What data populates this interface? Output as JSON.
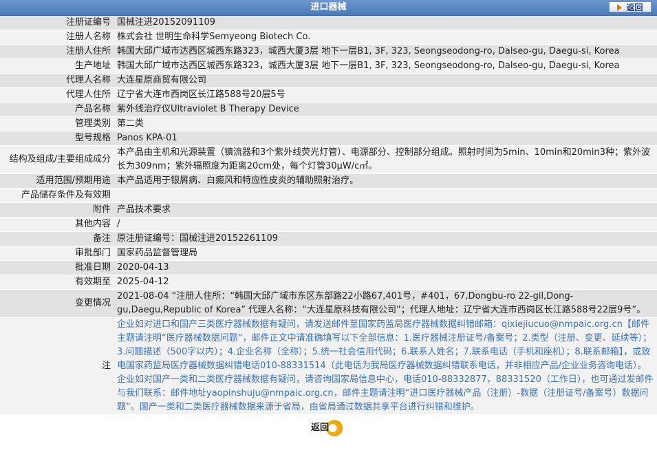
{
  "header": {
    "title": "进口器械",
    "back_label": "返回"
  },
  "rows": [
    {
      "label": "注册证编号",
      "value": "国械注进20152091109"
    },
    {
      "label": "注册人名称",
      "value": "株式会社 世明生命科学Semyeong Biotech Co."
    },
    {
      "label": "注册人住所",
      "value": "韩国大邱广域市达西区城西东路323，城西大厦3层 地下一层B1, 3F, 323, Seongseodong-ro, Dalseo-gu, Daegu-si, Korea"
    },
    {
      "label": "生产地址",
      "value": "韩国大邱广域市达西区城西东路323，城西大厦3层 地下一层B1, 3F, 323, Seongseodong-ro, Dalseo-gu, Daegu-si, Korea"
    },
    {
      "label": "代理人名称",
      "value": "大连星原商贸有限公司"
    },
    {
      "label": "代理人住所",
      "value": "辽宁省大连市西岗区长江路588号20层5号"
    },
    {
      "label": "产品名称",
      "value": "紫外线治疗仪Ultraviolet B Therapy Device"
    },
    {
      "label": "管理类别",
      "value": "第二类"
    },
    {
      "label": "型号规格",
      "value": "Panos KPA-01"
    },
    {
      "label": "结构及组成/主要组成成分",
      "value": "本产品由主机和光源装置（镇流器和3个紫外线荧光灯管）、电源部分、控制部分组成。照射时间为5min、10min和20min3种；紫外波长为309nm；紫外辐照度为距离20cm处，每个灯管30μW/c㎡。"
    },
    {
      "label": "适用范围/预期用途",
      "value": "本产品适用于银屑病、白癜风和特应性皮炎的辅助照射治疗。"
    },
    {
      "label": "产品储存条件及有效期",
      "value": ""
    },
    {
      "label": "附件",
      "value": "产品技术要求"
    },
    {
      "label": "其他内容",
      "value": "/"
    },
    {
      "label": "备注",
      "value": "原注册证编号：国械注进20152261109"
    },
    {
      "label": "审批部门",
      "value": "国家药品监督管理局"
    },
    {
      "label": "批准日期",
      "value": "2020-04-13"
    },
    {
      "label": "有效期至",
      "value": "2025-04-12"
    },
    {
      "label": "变更情况",
      "value": "2021-08-04 “注册人住所：“韩国大邱广域市东区东部路22小路67,401号，#401，67,Dongbu-ro 22-gil,Dong-gu,Daegu,Republic of Korea” 代理人名称：“大连星原科技有限公司”；代理人地址：辽宁省大连市西岗区长江路588号22层9号”。"
    },
    {
      "label": "注",
      "value": "企业如对进口和国产三类医疗器械数据有疑问，请发送邮件至国家药监局医疗器械数据纠错邮箱：qixiejiucuo@nmpaic.org.cn【邮件主题请注明“医疗器械数据问题”，邮件正文中请准确填写以下全部信息：1.医疗器械注册证号/备案号；2.类型（注册、变更、延续等）；3.问题描述（500字以内）；4.企业名称（全称）；5.统一社会信用代码；6.联系人姓名；7.联系电话（手机和座机）；8.联系邮箱】，或致电国家药监局医疗器械数据纠错电话010-88331514（此电话为我局医疗器械数据纠错联系电话，并非相应产品/企业业务咨询电话）。企业如对国产一类和二类医疗器械数据有疑问，请咨询国家局信息中心，电话010-88332877，88331520（工作日），也可通过发邮件与我们联系：邮件地址yaopinshuju@nmpaic.org.cn，邮件主题请注明“进口医疗器械产品（注册）-数据（注册证号/备案号）数据问题”。国产一类和二类医疗器械数据来源于省局，由省局通过数据共享平台进行纠错和维护。"
    }
  ],
  "footer": {
    "back_label": "返回"
  }
}
